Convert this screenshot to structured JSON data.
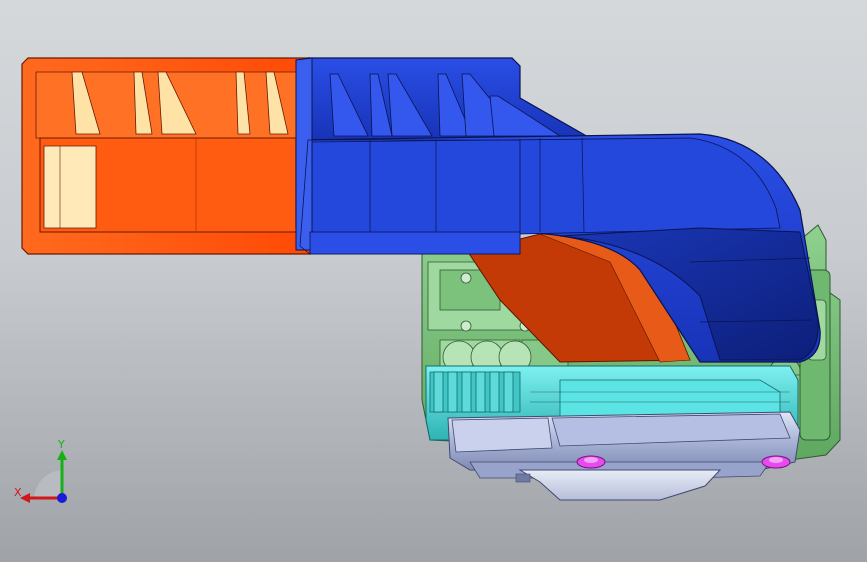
{
  "viewport": {
    "description_colors": {
      "background_top": "#d5d8db",
      "background_bottom": "#9fa3a8"
    },
    "parts": [
      {
        "name": "orange-shroud",
        "color": "#ff5a14"
      },
      {
        "name": "blue-duct",
        "color": "#1c3fd0"
      },
      {
        "name": "green-housing",
        "color": "#77c078"
      },
      {
        "name": "cyan-fan-ring",
        "color": "#46d2d2"
      },
      {
        "name": "grey-motor-base",
        "color": "#b9c2dd"
      },
      {
        "name": "magenta-fasteners",
        "color": "#e040e6"
      }
    ]
  },
  "triad": {
    "x_label": "X",
    "y_label": "Y",
    "x_color": "#d01818",
    "y_color": "#18b018",
    "z_color": "#1a1ad8"
  }
}
